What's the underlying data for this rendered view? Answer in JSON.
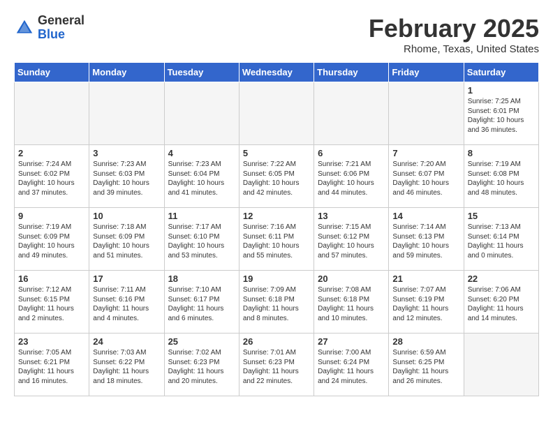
{
  "logo": {
    "general": "General",
    "blue": "Blue"
  },
  "title": "February 2025",
  "location": "Rhome, Texas, United States",
  "days": [
    "Sunday",
    "Monday",
    "Tuesday",
    "Wednesday",
    "Thursday",
    "Friday",
    "Saturday"
  ],
  "weeks": [
    [
      {
        "day": "",
        "content": ""
      },
      {
        "day": "",
        "content": ""
      },
      {
        "day": "",
        "content": ""
      },
      {
        "day": "",
        "content": ""
      },
      {
        "day": "",
        "content": ""
      },
      {
        "day": "",
        "content": ""
      },
      {
        "day": "1",
        "content": "Sunrise: 7:25 AM\nSunset: 6:01 PM\nDaylight: 10 hours\nand 36 minutes."
      }
    ],
    [
      {
        "day": "2",
        "content": "Sunrise: 7:24 AM\nSunset: 6:02 PM\nDaylight: 10 hours\nand 37 minutes."
      },
      {
        "day": "3",
        "content": "Sunrise: 7:23 AM\nSunset: 6:03 PM\nDaylight: 10 hours\nand 39 minutes."
      },
      {
        "day": "4",
        "content": "Sunrise: 7:23 AM\nSunset: 6:04 PM\nDaylight: 10 hours\nand 41 minutes."
      },
      {
        "day": "5",
        "content": "Sunrise: 7:22 AM\nSunset: 6:05 PM\nDaylight: 10 hours\nand 42 minutes."
      },
      {
        "day": "6",
        "content": "Sunrise: 7:21 AM\nSunset: 6:06 PM\nDaylight: 10 hours\nand 44 minutes."
      },
      {
        "day": "7",
        "content": "Sunrise: 7:20 AM\nSunset: 6:07 PM\nDaylight: 10 hours\nand 46 minutes."
      },
      {
        "day": "8",
        "content": "Sunrise: 7:19 AM\nSunset: 6:08 PM\nDaylight: 10 hours\nand 48 minutes."
      }
    ],
    [
      {
        "day": "9",
        "content": "Sunrise: 7:19 AM\nSunset: 6:09 PM\nDaylight: 10 hours\nand 49 minutes."
      },
      {
        "day": "10",
        "content": "Sunrise: 7:18 AM\nSunset: 6:09 PM\nDaylight: 10 hours\nand 51 minutes."
      },
      {
        "day": "11",
        "content": "Sunrise: 7:17 AM\nSunset: 6:10 PM\nDaylight: 10 hours\nand 53 minutes."
      },
      {
        "day": "12",
        "content": "Sunrise: 7:16 AM\nSunset: 6:11 PM\nDaylight: 10 hours\nand 55 minutes."
      },
      {
        "day": "13",
        "content": "Sunrise: 7:15 AM\nSunset: 6:12 PM\nDaylight: 10 hours\nand 57 minutes."
      },
      {
        "day": "14",
        "content": "Sunrise: 7:14 AM\nSunset: 6:13 PM\nDaylight: 10 hours\nand 59 minutes."
      },
      {
        "day": "15",
        "content": "Sunrise: 7:13 AM\nSunset: 6:14 PM\nDaylight: 11 hours\nand 0 minutes."
      }
    ],
    [
      {
        "day": "16",
        "content": "Sunrise: 7:12 AM\nSunset: 6:15 PM\nDaylight: 11 hours\nand 2 minutes."
      },
      {
        "day": "17",
        "content": "Sunrise: 7:11 AM\nSunset: 6:16 PM\nDaylight: 11 hours\nand 4 minutes."
      },
      {
        "day": "18",
        "content": "Sunrise: 7:10 AM\nSunset: 6:17 PM\nDaylight: 11 hours\nand 6 minutes."
      },
      {
        "day": "19",
        "content": "Sunrise: 7:09 AM\nSunset: 6:18 PM\nDaylight: 11 hours\nand 8 minutes."
      },
      {
        "day": "20",
        "content": "Sunrise: 7:08 AM\nSunset: 6:18 PM\nDaylight: 11 hours\nand 10 minutes."
      },
      {
        "day": "21",
        "content": "Sunrise: 7:07 AM\nSunset: 6:19 PM\nDaylight: 11 hours\nand 12 minutes."
      },
      {
        "day": "22",
        "content": "Sunrise: 7:06 AM\nSunset: 6:20 PM\nDaylight: 11 hours\nand 14 minutes."
      }
    ],
    [
      {
        "day": "23",
        "content": "Sunrise: 7:05 AM\nSunset: 6:21 PM\nDaylight: 11 hours\nand 16 minutes."
      },
      {
        "day": "24",
        "content": "Sunrise: 7:03 AM\nSunset: 6:22 PM\nDaylight: 11 hours\nand 18 minutes."
      },
      {
        "day": "25",
        "content": "Sunrise: 7:02 AM\nSunset: 6:23 PM\nDaylight: 11 hours\nand 20 minutes."
      },
      {
        "day": "26",
        "content": "Sunrise: 7:01 AM\nSunset: 6:23 PM\nDaylight: 11 hours\nand 22 minutes."
      },
      {
        "day": "27",
        "content": "Sunrise: 7:00 AM\nSunset: 6:24 PM\nDaylight: 11 hours\nand 24 minutes."
      },
      {
        "day": "28",
        "content": "Sunrise: 6:59 AM\nSunset: 6:25 PM\nDaylight: 11 hours\nand 26 minutes."
      },
      {
        "day": "",
        "content": ""
      }
    ]
  ]
}
